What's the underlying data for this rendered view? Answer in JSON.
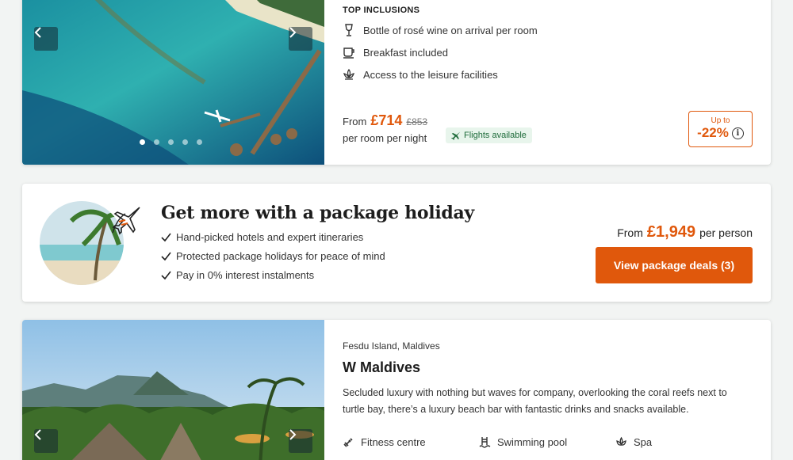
{
  "card1": {
    "inclusions_title": "TOP INCLUSIONS",
    "inclusions": [
      {
        "icon": "wine-glass-icon",
        "label": "Bottle of rosé wine on arrival per room"
      },
      {
        "icon": "coffee-cup-icon",
        "label": "Breakfast included"
      },
      {
        "icon": "lotus-icon",
        "label": "Access to the leisure facilities"
      }
    ],
    "price_from": "From",
    "price": "£714",
    "price_was": "£853",
    "price_sub": "per room per night",
    "flights_label": "Flights available",
    "discount_upto": "Up to",
    "discount_pct": "-22%",
    "carousel": {
      "count": 5,
      "active": 0
    }
  },
  "card2": {
    "title": "Get more with a package holiday",
    "bullets": [
      "Hand-picked hotels and expert itineraries",
      "Protected package holidays for peace of mind",
      "Pay in 0% interest instalments"
    ],
    "price_from": "From",
    "price": "£1,949",
    "price_suffix": "per person",
    "button_label": "View package deals (3)"
  },
  "card3": {
    "location": "Fesdu Island, Maldives",
    "hotel_name": "W Maldives",
    "description": "Secluded luxury with nothing but waves for company, overlooking the coral reefs next to turtle bay, there’s a luxury beach bar with fantastic drinks and snacks available.",
    "facilities": [
      {
        "icon": "fitness-icon",
        "label": "Fitness centre"
      },
      {
        "icon": "swimming-pool-icon",
        "label": "Swimming pool"
      },
      {
        "icon": "spa-icon",
        "label": "Spa"
      }
    ]
  },
  "colors": {
    "accent": "#e0580c",
    "flights_bg": "#e8f5ec",
    "flights_text": "#1e6b3a"
  }
}
